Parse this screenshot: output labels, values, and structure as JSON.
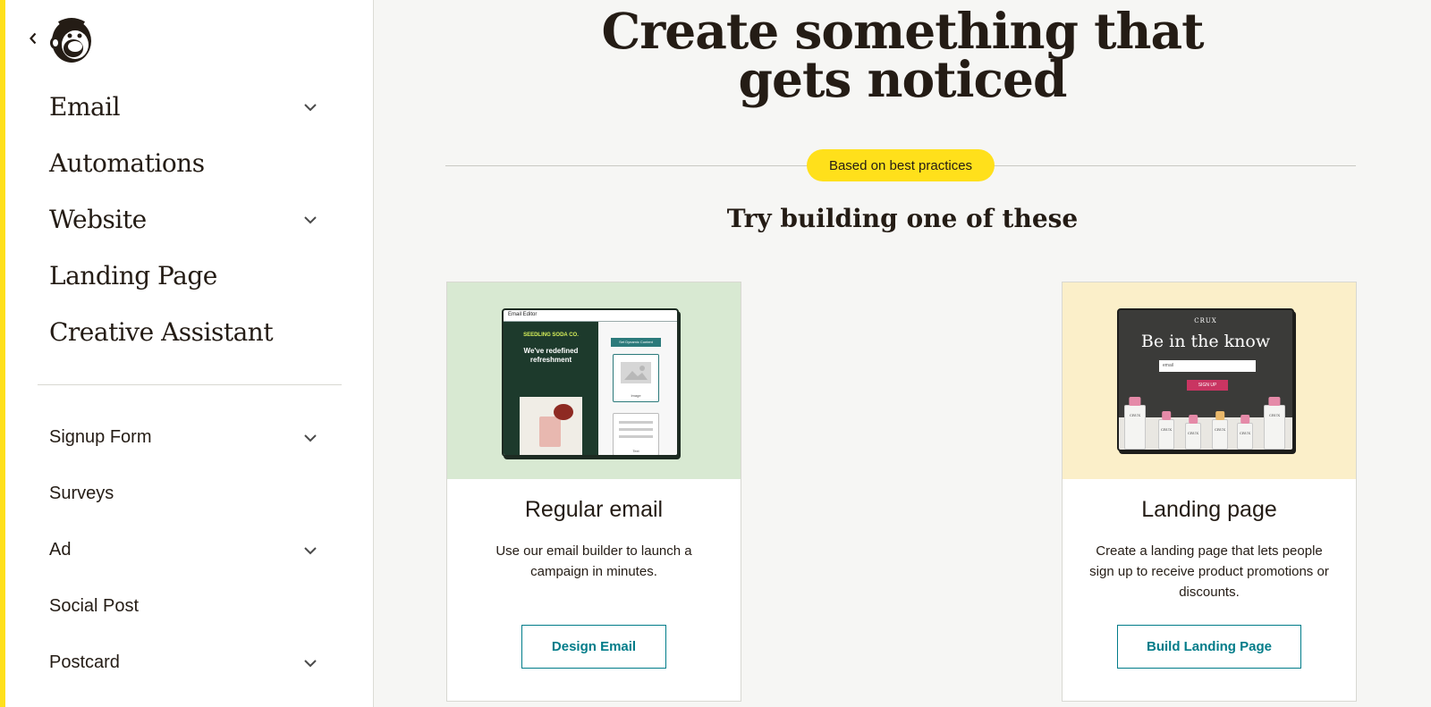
{
  "sidebar": {
    "primary": [
      {
        "label": "Email",
        "has_submenu": true
      },
      {
        "label": "Automations",
        "has_submenu": false
      },
      {
        "label": "Website",
        "has_submenu": true
      },
      {
        "label": "Landing Page",
        "has_submenu": false
      },
      {
        "label": "Creative Assistant",
        "has_submenu": false
      }
    ],
    "secondary": [
      {
        "label": "Signup Form",
        "has_submenu": true
      },
      {
        "label": "Surveys",
        "has_submenu": false
      },
      {
        "label": "Ad",
        "has_submenu": true
      },
      {
        "label": "Social Post",
        "has_submenu": false
      },
      {
        "label": "Postcard",
        "has_submenu": true
      }
    ]
  },
  "main": {
    "headline_line1": "Create something that",
    "headline_line2": "gets noticed",
    "badge": "Based on best practices",
    "subheading": "Try building one of these",
    "cards": [
      {
        "title": "Regular email",
        "description": "Use our email builder to launch a campaign in minutes.",
        "button": "Design Email",
        "mock": {
          "window_title": "Email Editor",
          "brand": "SEEDLING SODA CO.",
          "hero": "We've redefined refreshment",
          "tag": "Set Dynamic Content",
          "image_caption": "Image",
          "text_caption": "Text"
        }
      },
      {
        "title": "Landing page",
        "description": "Create a landing page that lets people sign up to receive product promotions or discounts.",
        "button": "Build Landing Page",
        "mock": {
          "brand": "CRUX",
          "hero": "Be in the know",
          "field_placeholder": "email",
          "button": "SIGN UP",
          "bottle_label": "CRUX"
        }
      }
    ]
  },
  "colors": {
    "accent": "#ffe01b",
    "teal": "#007c89",
    "email_thumb_bg": "#d8e9d2",
    "landing_thumb_bg": "#fbefc9"
  }
}
